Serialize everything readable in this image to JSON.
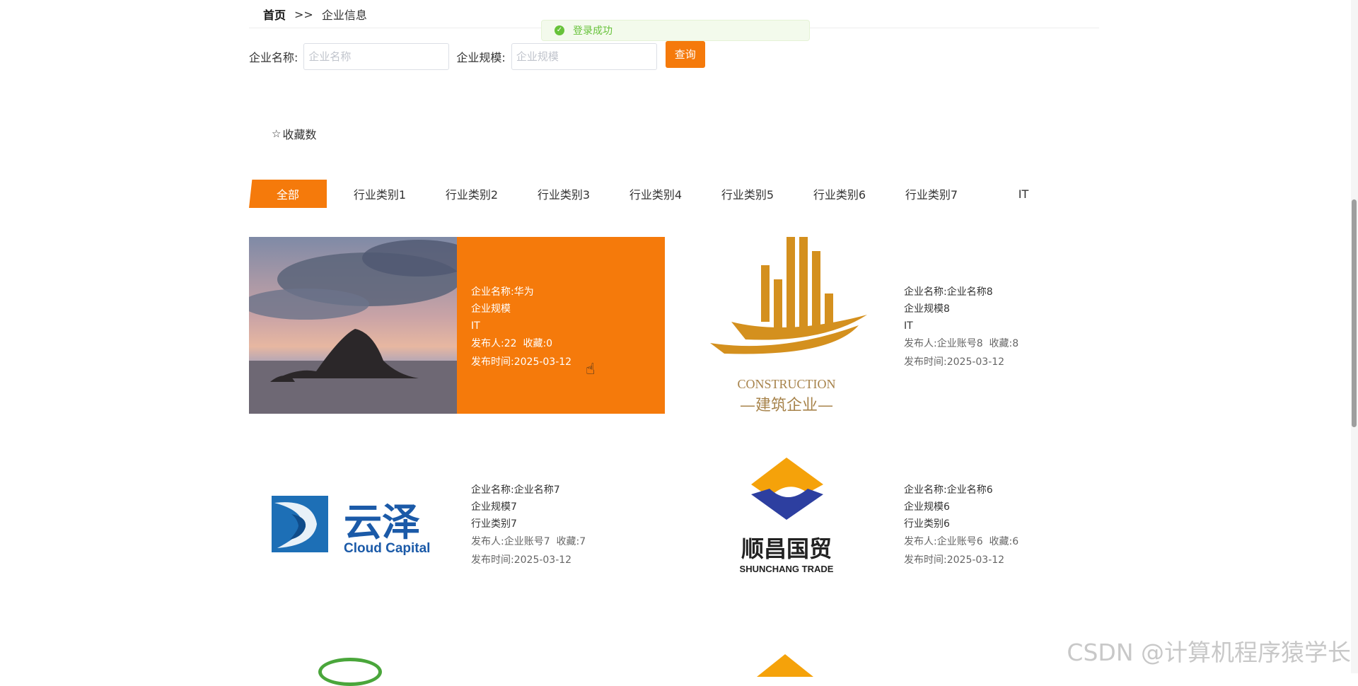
{
  "breadcrumb": {
    "home": "首页",
    "separator": ">>",
    "current": "企业信息"
  },
  "toast": {
    "message": "登录成功",
    "icon": "check-circle-icon"
  },
  "search": {
    "name_label": "企业名称:",
    "name_placeholder": "企业名称",
    "scale_label": "企业规模:",
    "scale_placeholder": "企业规模",
    "button_label": "查询"
  },
  "sort": {
    "label": "收藏数",
    "icon": "star-outline-icon"
  },
  "categories": [
    "全部",
    "行业类别1",
    "行业类别2",
    "行业类别3",
    "行业类别4",
    "行业类别5",
    "行业类别6",
    "行业类别7",
    "IT"
  ],
  "active_category_index": 0,
  "cards": [
    {
      "name": "企业名称:华为",
      "scale": "企业规模",
      "category": "IT",
      "publisher_label": "发布人:",
      "publisher": "22",
      "fav_label": "收藏:",
      "favs": "0",
      "time_label": "发布时间:",
      "time": "2025-03-12",
      "image": "seaside-rock-photo",
      "highlighted": true
    },
    {
      "name": "企业名称:企业名称8",
      "scale": "企业规模8",
      "category": "IT",
      "publisher_label": "发布人:",
      "publisher": "企业账号8",
      "fav_label": "收藏:",
      "favs": "8",
      "time_label": "发布时间:",
      "time": "2025-03-12",
      "image": "construction-logo",
      "logo_text_en": "CONSTRUCTION",
      "logo_text_cn": "—建筑企业—"
    },
    {
      "name": "企业名称:企业名称7",
      "scale": "企业规模7",
      "category": "行业类别7",
      "publisher_label": "发布人:",
      "publisher": "企业账号7",
      "fav_label": "收藏:",
      "favs": "7",
      "time_label": "发布时间:",
      "time": "2025-03-12",
      "image": "cloud-capital-logo",
      "logo_text_cn": "云泽",
      "logo_text_en": "Cloud Capital"
    },
    {
      "name": "企业名称:企业名称6",
      "scale": "企业规模6",
      "category": "行业类别6",
      "publisher_label": "发布人:",
      "publisher": "企业账号6",
      "fav_label": "收藏:",
      "favs": "6",
      "time_label": "发布时间:",
      "time": "2025-03-12",
      "image": "shunchang-logo",
      "logo_text_cn": "顺昌国贸",
      "logo_text_en": "SHUNCHANG TRADE"
    }
  ],
  "watermark": "CSDN @计算机程序猿学长",
  "colors": {
    "accent": "#f57a0b",
    "success": "#67c23a"
  }
}
